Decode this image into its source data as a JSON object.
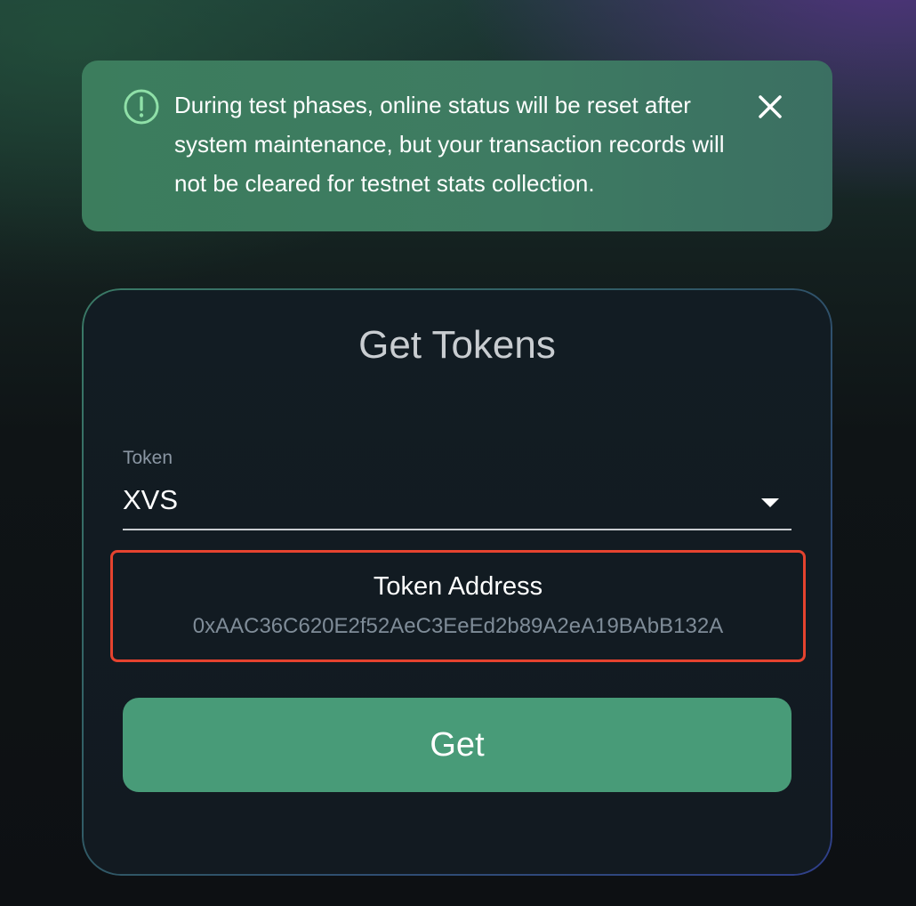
{
  "banner": {
    "icon": "exclamation-circle-icon",
    "message": "During test phases, online status will be reset after system maintenance, but your transaction records will not be cleared for testnet stats collection.",
    "close_icon": "close-icon",
    "color": "#3c7d5d"
  },
  "card": {
    "title": "Get Tokens",
    "token_field": {
      "label": "Token",
      "value": "XVS",
      "dropdown_icon": "caret-down-icon"
    },
    "token_address": {
      "title": "Token Address",
      "value": "0xAAC36C620E2f52AeC3EeEd2b89A2eA19BAbB132A",
      "highlight_color": "#e5432f"
    },
    "get_button_label": "Get",
    "accent_color": "#489b78"
  }
}
